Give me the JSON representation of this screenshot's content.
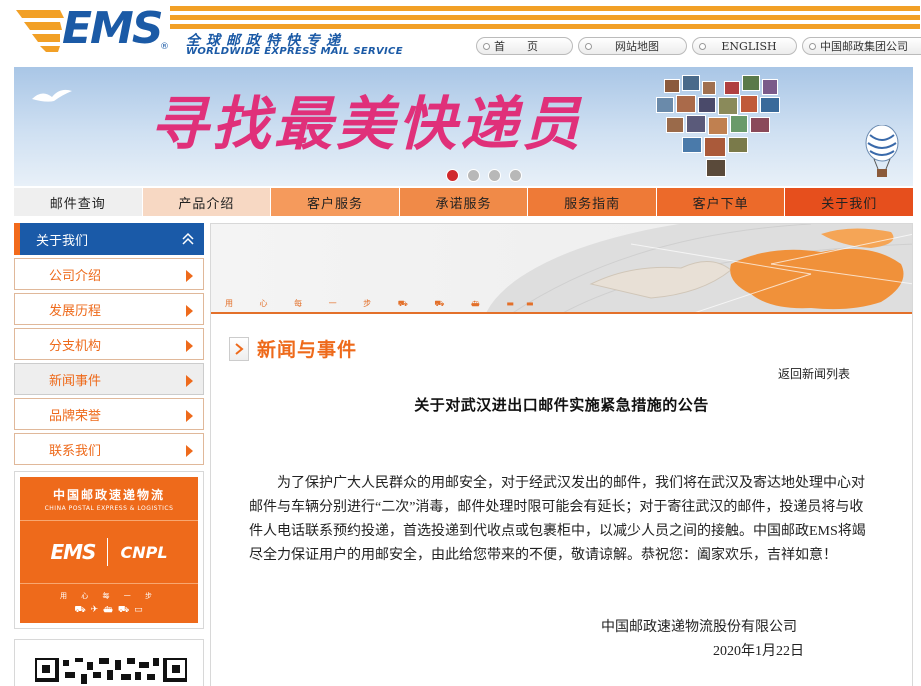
{
  "header": {
    "logo_text": "EMS",
    "logo_reg": "®",
    "logo_cn": "全球邮政特快专递",
    "logo_en": "WORLDWIDE EXPRESS MAIL SERVICE",
    "toplinks": [
      {
        "label": "首　　页"
      },
      {
        "label": "网站地图"
      },
      {
        "label": "ENGLISH"
      },
      {
        "label": "中国邮政集团公司"
      }
    ]
  },
  "banner": {
    "headline": "寻找最美快递员",
    "slides": 4,
    "active_slide": 1
  },
  "nav": {
    "items": [
      {
        "label": "邮件查询",
        "color": "#efefef"
      },
      {
        "label": "产品介绍",
        "color": "#f7d8c3"
      },
      {
        "label": "客户服务",
        "color": "#f59a5c"
      },
      {
        "label": "承诺服务",
        "color": "#f08a48"
      },
      {
        "label": "服务指南",
        "color": "#ee7a37"
      },
      {
        "label": "客户下单",
        "color": "#ec6a2a"
      },
      {
        "label": "关于我们",
        "color": "#e64f1d"
      }
    ]
  },
  "sidebar": {
    "heading": "关于我们",
    "items": [
      {
        "label": "公司介绍",
        "active": false
      },
      {
        "label": "发展历程",
        "active": false
      },
      {
        "label": "分支机构",
        "active": false
      },
      {
        "label": "新闻事件",
        "active": true
      },
      {
        "label": "品牌荣誉",
        "active": false
      },
      {
        "label": "联系我们",
        "active": false
      }
    ],
    "promo": {
      "cn": "中国邮政速递物流",
      "en": "CHINA POSTAL EXPRESS & LOGISTICS",
      "ems": "EMS",
      "cnpl": "CNPL",
      "slogan": "用 心 每 一 步"
    }
  },
  "main": {
    "slogan": "用 心 每 一 步",
    "section_title": "新闻与事件",
    "back_link": "返回新闻列表",
    "article": {
      "title": "关于对武汉进出口邮件实施紧急措施的公告",
      "body": "为了保护广大人民群众的用邮安全，对于经武汉发出的邮件，我们将在武汉及寄达地处理中心对邮件与车辆分别进行“二次”消毒，邮件处理时限可能会有延长；对于寄往武汉的邮件，投递员将与收件人电话联系预约投递，首选投递到代收点或包裹柜中，以减少人员之间的接触。中国邮政EMS将竭尽全力保证用户的用邮安全，由此给您带来的不便，敬请谅解。恭祝您：阖家欢乐，吉祥如意！",
      "signature_company": "中国邮政速递物流股份有限公司",
      "signature_date": "2020年1月22日"
    }
  },
  "colors": {
    "brand_blue": "#1a5aa8",
    "brand_orange": "#ee6a1b",
    "stripe": "#f2a026"
  }
}
